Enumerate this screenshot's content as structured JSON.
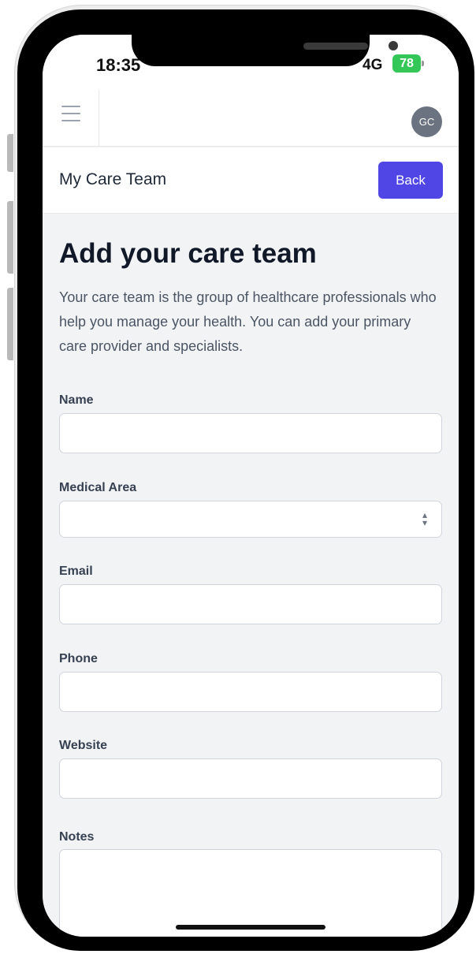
{
  "status_bar": {
    "time": "18:35",
    "network": "4G",
    "battery": "78"
  },
  "header": {
    "menu_icon": "hamburger-menu-icon",
    "avatar_initials": "GC"
  },
  "subheader": {
    "title": "My Care Team",
    "back_label": "Back"
  },
  "page": {
    "title": "Add your care team",
    "description": "Your care team is the group of healthcare professionals who help you manage your health. You can add your primary care provider and specialists."
  },
  "form": {
    "name_label": "Name",
    "name_value": "",
    "medical_area_label": "Medical Area",
    "medical_area_value": "",
    "email_label": "Email",
    "email_value": "",
    "phone_label": "Phone",
    "phone_value": "",
    "website_label": "Website",
    "website_value": "",
    "notes_label": "Notes",
    "notes_value": ""
  },
  "colors": {
    "accent": "#4f46e5",
    "battery": "#33c758",
    "background": "#f2f3f5"
  }
}
